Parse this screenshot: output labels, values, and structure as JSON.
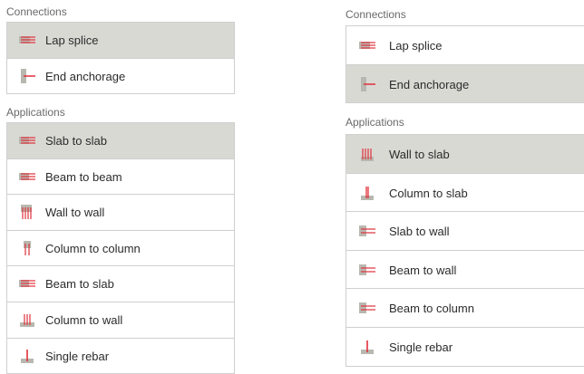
{
  "left": {
    "connections": {
      "heading": "Connections",
      "items": [
        {
          "label": "Lap splice",
          "icon": "lap-splice-icon",
          "selected": true
        },
        {
          "label": "End anchorage",
          "icon": "end-anchorage-icon",
          "selected": false
        }
      ]
    },
    "applications": {
      "heading": "Applications",
      "items": [
        {
          "label": "Slab to slab",
          "icon": "slab-to-slab-icon",
          "selected": true
        },
        {
          "label": "Beam to beam",
          "icon": "beam-to-beam-icon",
          "selected": false
        },
        {
          "label": "Wall to wall",
          "icon": "wall-to-wall-icon",
          "selected": false
        },
        {
          "label": "Column to column",
          "icon": "column-to-column-icon",
          "selected": false
        },
        {
          "label": "Beam to slab",
          "icon": "beam-to-slab-icon",
          "selected": false
        },
        {
          "label": "Column to wall",
          "icon": "column-to-wall-icon",
          "selected": false
        },
        {
          "label": "Single rebar",
          "icon": "single-rebar-icon",
          "selected": false
        }
      ]
    }
  },
  "right": {
    "connections": {
      "heading": "Connections",
      "items": [
        {
          "label": "Lap splice",
          "icon": "lap-splice-icon",
          "selected": false
        },
        {
          "label": "End anchorage",
          "icon": "end-anchorage-icon",
          "selected": true
        }
      ]
    },
    "applications": {
      "heading": "Applications",
      "items": [
        {
          "label": "Wall to slab",
          "icon": "wall-to-slab-icon",
          "selected": true
        },
        {
          "label": "Column to slab",
          "icon": "column-to-slab-icon",
          "selected": false
        },
        {
          "label": "Slab to wall",
          "icon": "slab-to-wall-icon",
          "selected": false
        },
        {
          "label": "Beam to wall",
          "icon": "beam-to-wall-icon",
          "selected": false
        },
        {
          "label": "Beam to column",
          "icon": "beam-to-column-icon",
          "selected": false
        },
        {
          "label": "Single rebar",
          "icon": "single-rebar-icon",
          "selected": false
        }
      ]
    }
  },
  "colors": {
    "selected_bg": "#d9d9d4",
    "border": "#cfcfcf",
    "rebar_red": "#e0303a",
    "concrete_grey": "#b8b8b0"
  }
}
